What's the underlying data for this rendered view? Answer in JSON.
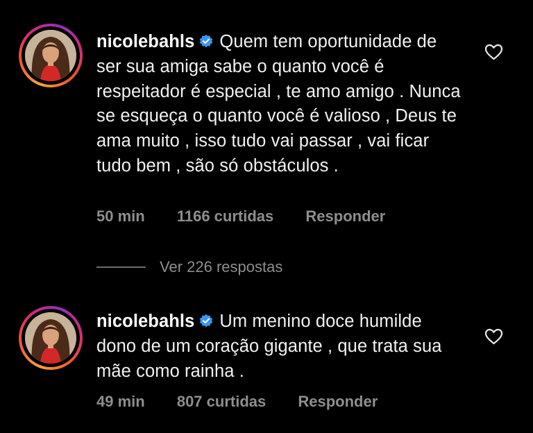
{
  "comments": [
    {
      "username": "nicolebahls",
      "text": "Quem tem oportunidade de ser sua amiga sabe o quanto você é respeitador é especial , te amo amigo . Nunca se esqueça o quanto você é valioso , Deus te ama muito , isso tudo vai passar , vai ficar tudo bem , são só obstáculos .",
      "time": "50 min",
      "likes": "1166 curtidas",
      "reply_label": "Responder"
    },
    {
      "username": "nicolebahls",
      "text": "Um menino doce humilde dono de um coração gigante , que trata sua mãe como rainha .",
      "time": "49 min",
      "likes": "807 curtidas",
      "reply_label": "Responder"
    }
  ],
  "replies_toggle": "Ver 226 respostas",
  "colors": {
    "background": "#000000",
    "text": "#f2f2f2",
    "muted": "#8e8e8e",
    "verified_badge": "#3897f0"
  },
  "icons": {
    "verified": "verified-badge-icon",
    "like": "heart-icon"
  }
}
